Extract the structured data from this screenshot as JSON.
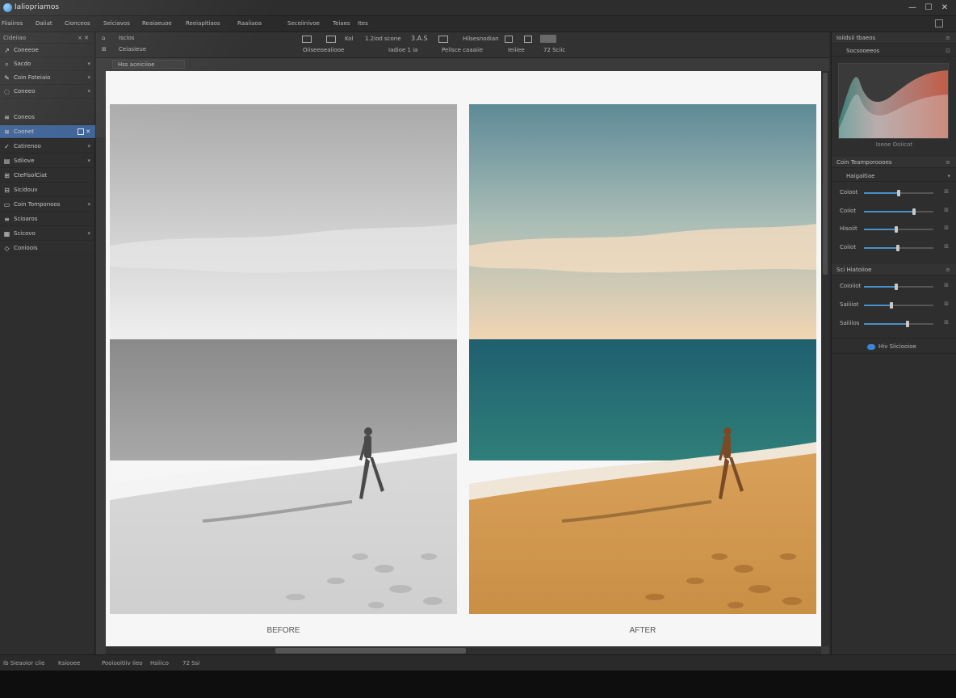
{
  "app": {
    "title": "Ialiopriamos"
  },
  "menu": [
    "Fiiaiiros",
    "Daiiat",
    "Cionceos",
    "Seiciavos",
    "Reaiaeuoe",
    "Reeiapitiaos",
    "Raaiiaoa",
    "Seceiinivoe",
    "Teiaes",
    "Ites"
  ],
  "left_panel": {
    "header": "Cideiiao",
    "items": [
      {
        "icon": "↗",
        "label": "Coneeoe"
      },
      {
        "icon": "⌕",
        "label": "Sacdo"
      },
      {
        "icon": "✎",
        "label": "Coin Foteiaio"
      },
      {
        "icon": "◌",
        "label": "Coneeo"
      },
      {
        "icon": "≋",
        "label": "Coneos"
      },
      {
        "icon": "≋",
        "label": "Coonet"
      },
      {
        "icon": "✓",
        "label": "Catirenoo"
      },
      {
        "icon": "▤",
        "label": "Sdiiove"
      },
      {
        "icon": "⊞",
        "label": "CteFisolCiat"
      },
      {
        "icon": "⊟",
        "label": "Sicidouv"
      },
      {
        "icon": "▭",
        "label": "Coin Tomponoos"
      },
      {
        "icon": "≡",
        "label": "Scioaros"
      },
      {
        "icon": "▦",
        "label": "Scicovo"
      },
      {
        "icon": "◇",
        "label": "Conioois"
      }
    ]
  },
  "toolbar": {
    "top_labels": [
      "Iscios",
      "Ceiasieue"
    ],
    "row1": [
      "Kol",
      "1.2iod  scone",
      "3.A.S",
      "Hilsesnodian"
    ],
    "row2": [
      "Oiiseeoeaiiooe",
      "Iadioe  1 ia",
      "Pelisce caaaiie",
      "Ieiiiee",
      "72  Sciic"
    ],
    "doc_tab": "Hss aceiciioe"
  },
  "canvas": {
    "before_caption": "BEFORE",
    "after_caption": "AFTER"
  },
  "right_panel": {
    "header1": "Ioiidsii tbaeos",
    "sub1": "Socsooeeos",
    "histogram_caption": "Iseoe Ooiicot",
    "header2": "Coin Teamporoooes",
    "sub2": "Haigaitiae",
    "group1": [
      {
        "label": "Coioot",
        "value": 0.5
      },
      {
        "label": "Coiiot",
        "value": 0.72
      },
      {
        "label": "Hisoiit",
        "value": 0.46
      },
      {
        "label": "Coiiot",
        "value": 0.49
      }
    ],
    "header3": "Sci Hiatoiioe",
    "group2": [
      {
        "label": "Coioiiot",
        "value": 0.46
      },
      {
        "label": "Saiiiiot",
        "value": 0.39
      },
      {
        "label": "Saiiiios",
        "value": 0.63
      }
    ],
    "toggle_label": "Hiv Siiciooioe"
  },
  "status": [
    "Ib  Sieaoior clie",
    "Ksiooee",
    "Pooiooitiiv Iieo",
    "Hsiiico",
    "72 Ssi"
  ],
  "colors": {
    "accent": "#3a5f93",
    "slider": "#4a90c8"
  }
}
